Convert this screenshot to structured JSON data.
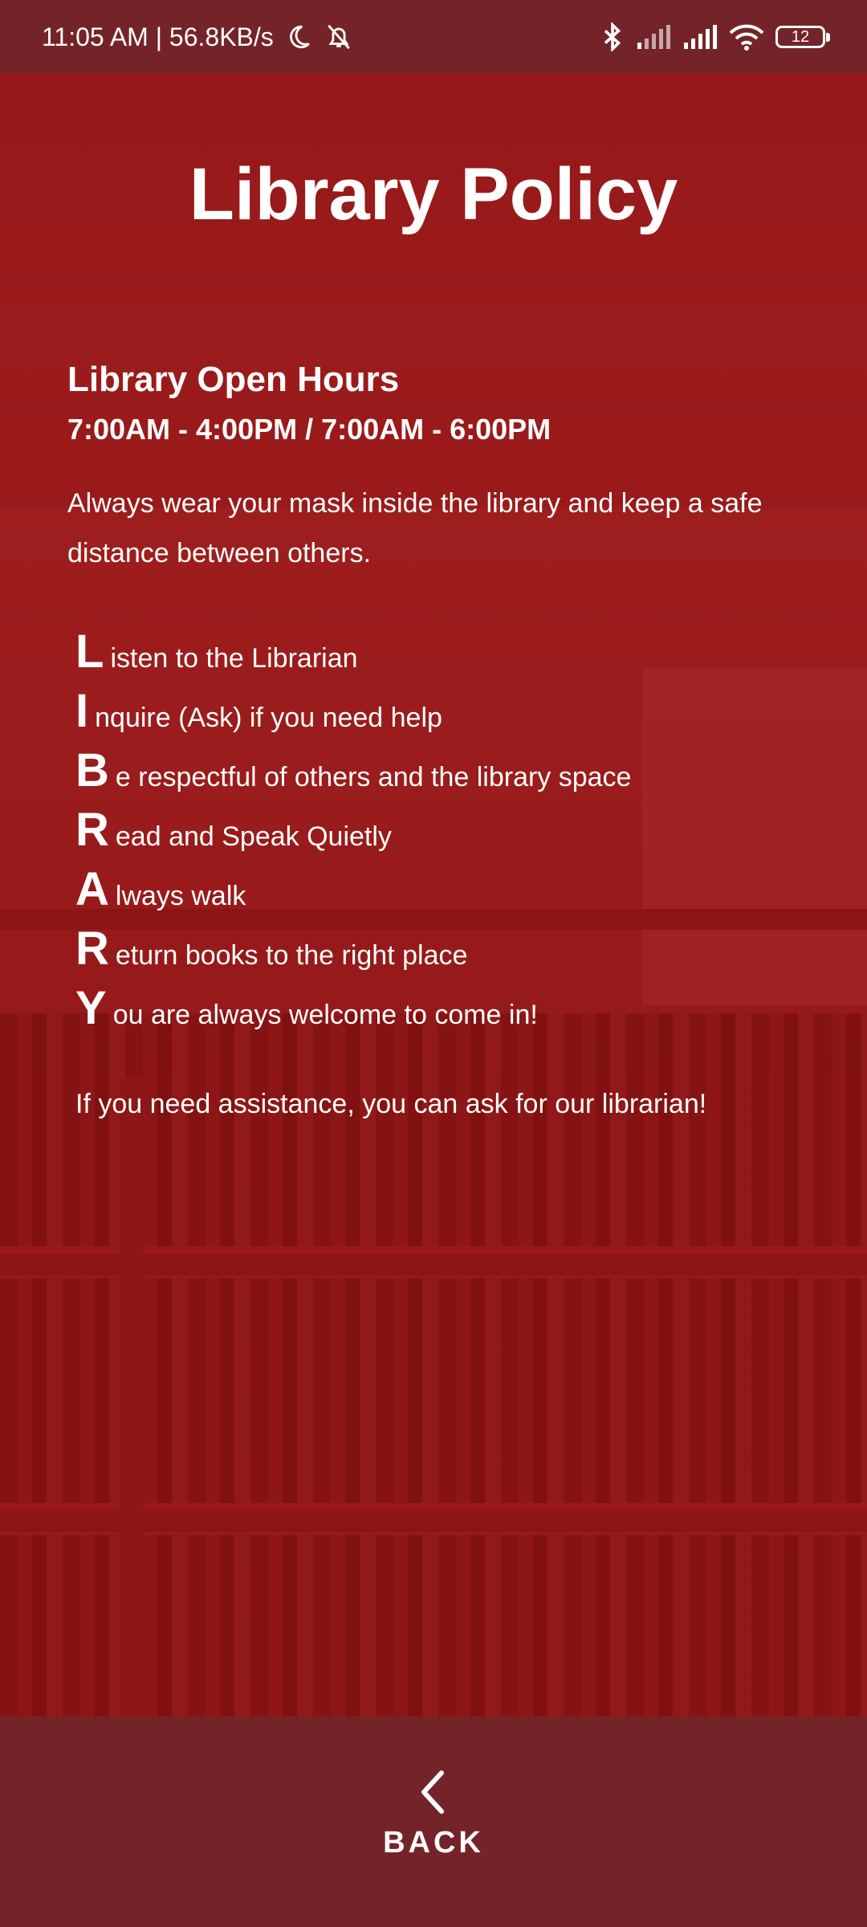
{
  "status_bar": {
    "time_speed": "11:05 AM | 56.8KB/s",
    "battery_level": "12",
    "icons": [
      "moon-icon",
      "alarm-off-icon",
      "bluetooth-icon",
      "signal-icon",
      "signal-icon",
      "wifi-icon",
      "battery-icon"
    ]
  },
  "page": {
    "title": "Library Policy",
    "hours_title": "Library Open Hours",
    "hours_range": "7:00AM - 4:00PM / 7:00AM - 6:00PM",
    "mask_note": "Always wear your mask inside the library and keep a safe distance between others.",
    "acrostic": [
      {
        "letter": "L",
        "rest": "isten to the Librarian"
      },
      {
        "letter": "I",
        "rest": "nquire (Ask) if you need help"
      },
      {
        "letter": "B",
        "rest": "e respectful of others and the library space"
      },
      {
        "letter": "R",
        "rest": "ead and Speak Quietly"
      },
      {
        "letter": "A",
        "rest": "lways walk"
      },
      {
        "letter": "R",
        "rest": "eturn books to the right place"
      },
      {
        "letter": "Y",
        "rest": "ou are always welcome to come in!"
      }
    ],
    "assist_note": "If you need assistance, you can ask for our librarian!"
  },
  "bottom_bar": {
    "back_label": "BACK",
    "back_icon": "chevron-left-icon"
  },
  "colors": {
    "bars": "#742428",
    "background": "#8e1818",
    "text": "#ffffff"
  }
}
